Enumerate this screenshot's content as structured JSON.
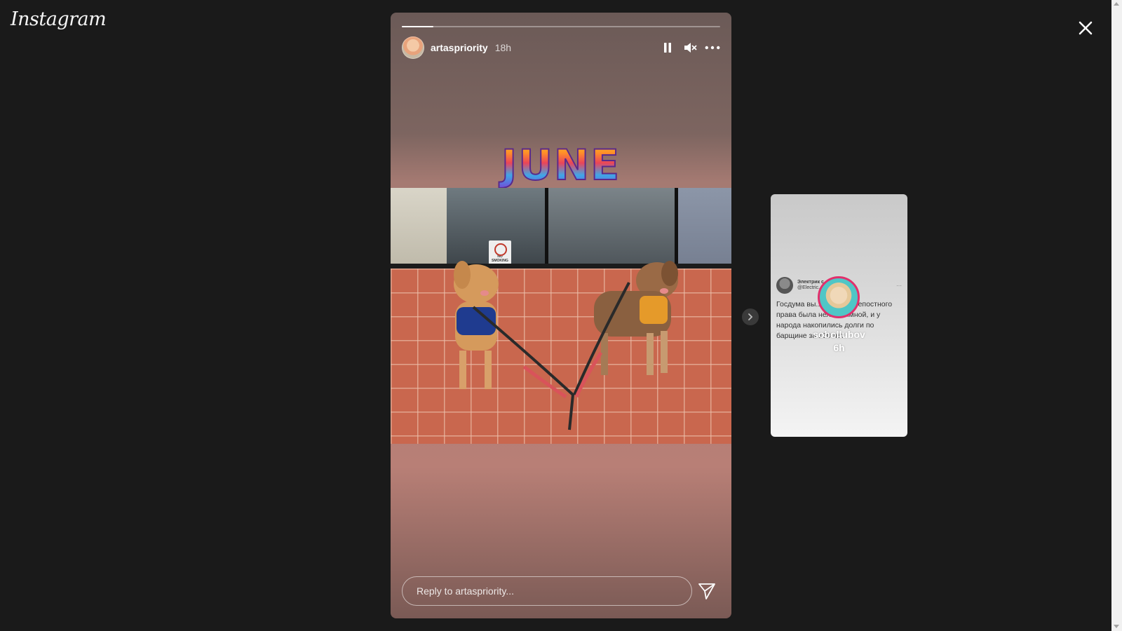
{
  "app": {
    "logo_text": "Instagram"
  },
  "story": {
    "username": "artaspriority",
    "time_ago": "18h",
    "progress_fraction": 0.1,
    "sticker_text": "JUNE",
    "sign_text": "NO SMOKING",
    "reply_placeholder": "Reply to artaspriority..."
  },
  "icons": {
    "close": "close-icon",
    "pause": "pause-icon",
    "mute": "muted-speaker-icon",
    "more": "more-options-icon",
    "send": "send-icon",
    "next": "chevron-right-icon"
  },
  "next_story": {
    "username": "sobollubov",
    "time_ago": "6h",
    "tweet": {
      "name": "Электрик с ...",
      "handle": "@Electric...",
      "text": "Госдума вы... отмена крепостного права была нелегитимной, и у народа накопились долги по барщине за 160 лет"
    }
  },
  "colors": {
    "background": "#1a1a1a",
    "text": "#ffffff",
    "story_ring": "#e1306c"
  }
}
